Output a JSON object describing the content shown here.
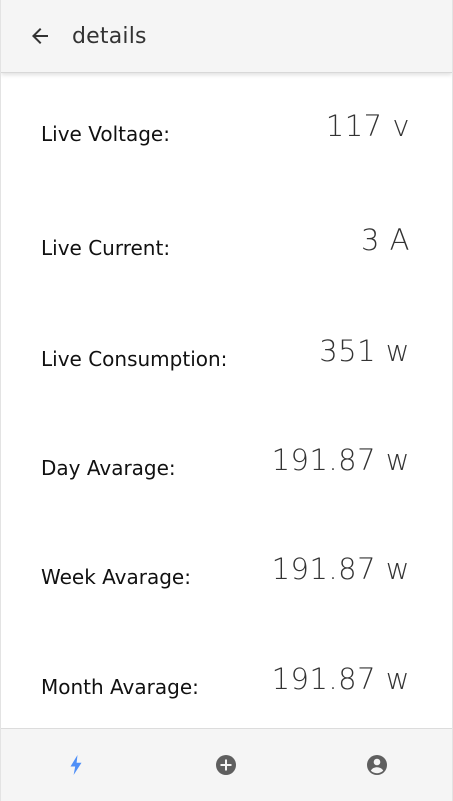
{
  "header": {
    "title": "details",
    "back_icon": "arrow-left-icon"
  },
  "metrics": [
    {
      "label": "Live Voltage:",
      "value": "117 v"
    },
    {
      "label": "Live Current:",
      "value": "3 A"
    },
    {
      "label": "Live Consumption:",
      "value": "351 w"
    },
    {
      "label": "Day Avarage:",
      "value": "191.87 w"
    },
    {
      "label": "Week Avarage:",
      "value": "191.87 w"
    },
    {
      "label": "Month Avarage:",
      "value": "191.87 w"
    }
  ],
  "bottom_nav": {
    "items": [
      {
        "icon": "bolt-icon",
        "active": true
      },
      {
        "icon": "plus-circle-icon",
        "active": false
      },
      {
        "icon": "account-circle-icon",
        "active": false
      }
    ]
  },
  "colors": {
    "active": "#4f8ff7",
    "inactive": "#5f5f5f",
    "bar_background": "#f5f5f5"
  }
}
